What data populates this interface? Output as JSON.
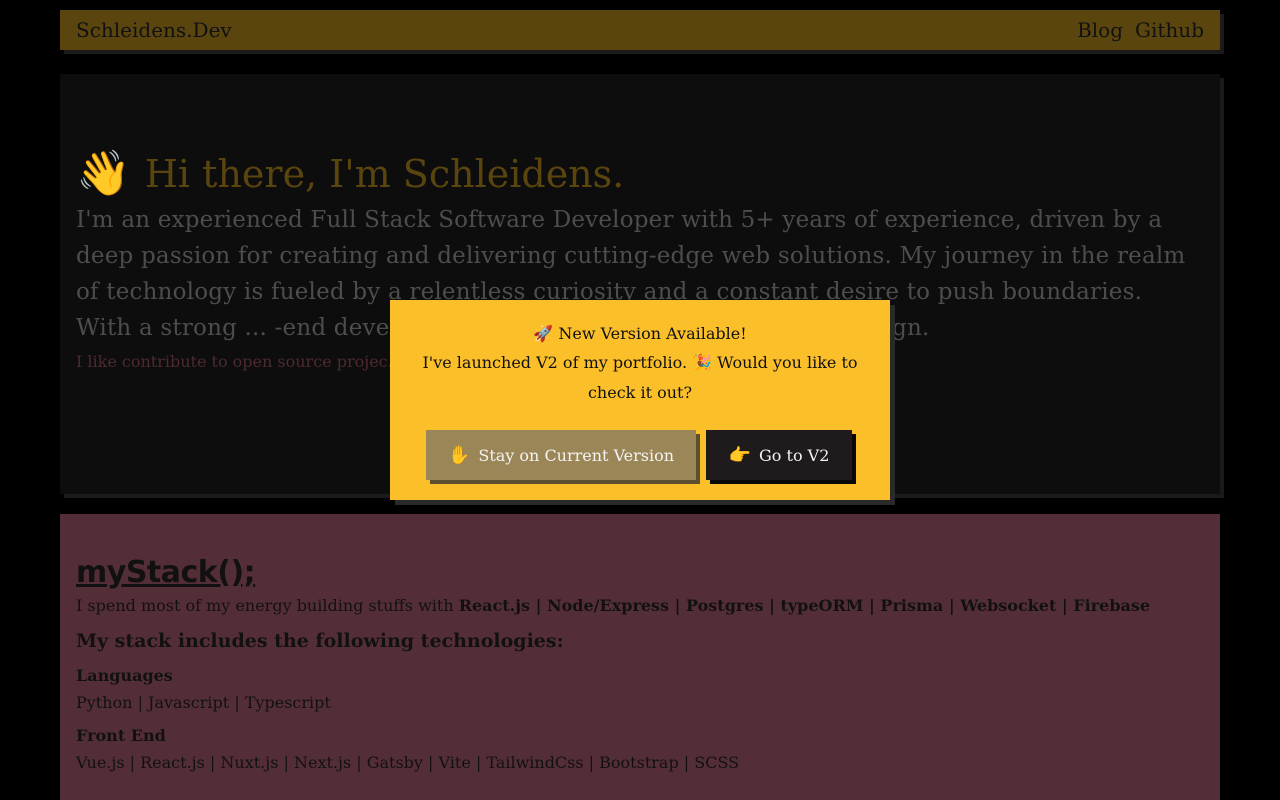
{
  "nav": {
    "brand": "Schleidens.Dev",
    "links": [
      "Blog",
      "Github"
    ]
  },
  "hero": {
    "wave_icon": "waving-hand-icon",
    "title": "Hi there, I'm Schleidens.",
    "description": "I'm an experienced Full Stack Software Developer with 5+ years of experience, driven by a deep passion for creating and delivering cutting-edge web solutions. My journey in the realm of technology is fueled by a relentless curiosity and a constant desire to push boundaries. With a strong ... -end development, I thrive in bringing ideas t... design.",
    "contrib": "I like contribute to open source projec..."
  },
  "stack": {
    "title": "myStack();",
    "intro_prefix": "I spend most of my energy building stuffs with ",
    "intro_tech": "React.js | Node/Express | Postgres | typeORM | Prisma | Websocket | Firebase",
    "subhead": "My stack includes the following technologies:",
    "categories": [
      {
        "name": "Languages",
        "items": "Python | Javascript | Typescript"
      },
      {
        "name": "Front End",
        "items": "Vue.js | React.js | Nuxt.js | Next.js | Gatsby | Vite | TailwindCss | Bootstrap | SCSS"
      }
    ]
  },
  "modal": {
    "title_icon": "rocket-icon",
    "title": "New Version Available!",
    "text_before_icon": "I've launched V2 of my portfolio.",
    "text_icon": "party-popper-icon",
    "text_after_icon": "Would you like to check it out?",
    "stay_button": "Stay on Current Version",
    "stay_icon": "raised-hand-icon",
    "go_button": "Go to V2",
    "go_icon": "pointing-hand-icon"
  },
  "colors": {
    "background": "#000000",
    "navbar": "#5a450e",
    "hero_bg": "#0d0d0d",
    "stack_bg": "#542e37",
    "modal_bg": "#fbbf2a",
    "stay_button": "#9b8658",
    "go_button": "#1f1b1c"
  }
}
